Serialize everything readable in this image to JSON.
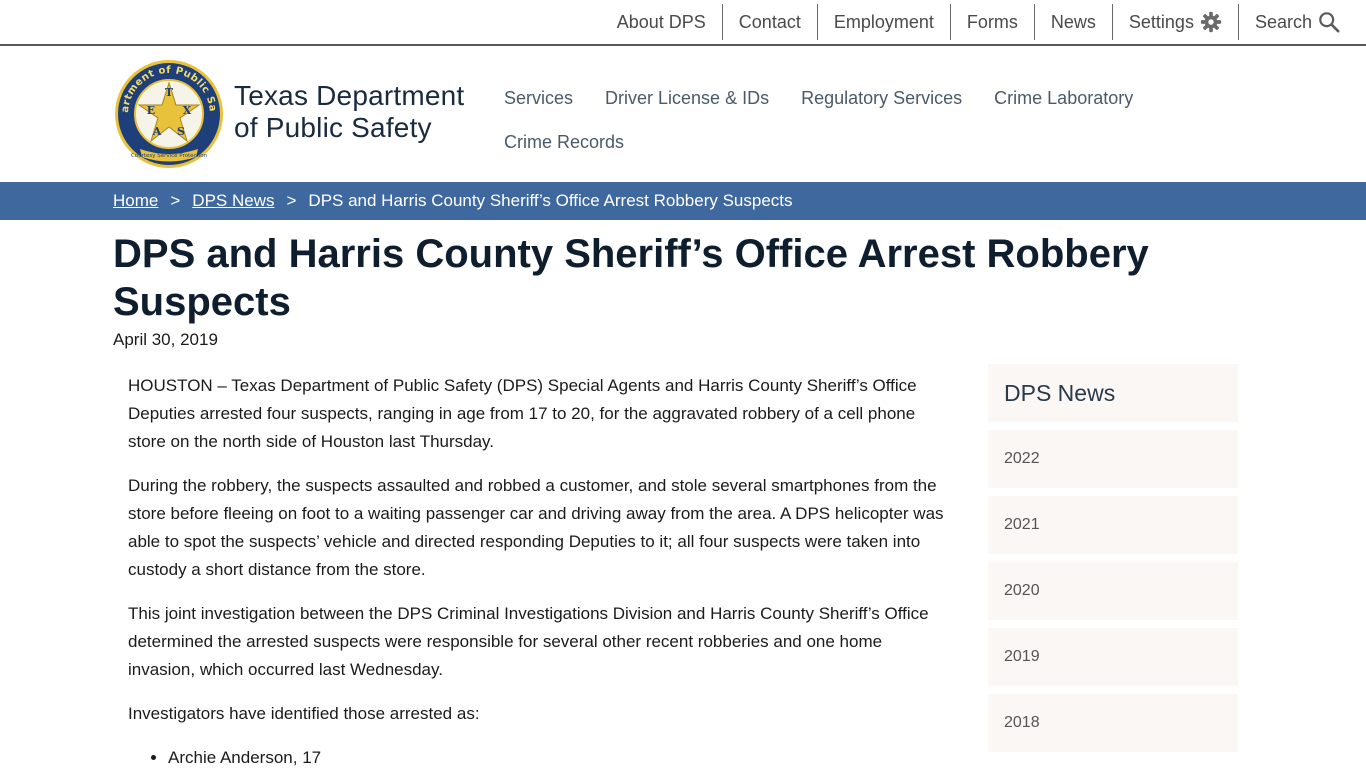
{
  "utility_nav": {
    "items": [
      "About DPS",
      "Contact",
      "Employment",
      "Forms",
      "News"
    ],
    "settings_label": "Settings",
    "search_label": "Search"
  },
  "header": {
    "agency_line1": "Texas Department",
    "agency_line2": "of Public Safety",
    "seal": {
      "ring_text": "Department of Public Safety",
      "star_letters": [
        "T",
        "E",
        "X",
        "A",
        "S"
      ],
      "ribbon_text": "Courtesy Service Protection"
    }
  },
  "main_nav": {
    "items": [
      "Services",
      "Driver License & IDs",
      "Regulatory Services",
      "Crime Laboratory",
      "Crime Records"
    ]
  },
  "breadcrumb": {
    "home": "Home",
    "news": "DPS News",
    "separator": ">",
    "current": "DPS and Harris County Sheriff’s Office Arrest Robbery Suspects"
  },
  "article": {
    "title": "DPS and Harris County Sheriff’s Office Arrest Robbery Suspects",
    "date": "April 30, 2019",
    "paragraphs": [
      "HOUSTON – Texas Department of Public Safety (DPS) Special Agents and Harris County Sheriff’s Office Deputies arrested four suspects, ranging in age from 17 to 20, for the aggravated robbery of a cell phone store on the north side of Houston last Thursday.",
      "During the robbery, the suspects assaulted and robbed a customer, and stole several smartphones from the store before fleeing on foot to a waiting passenger car and driving away from the area. A DPS helicopter was able to spot the suspects’ vehicle and directed responding Deputies to it; all four suspects were taken into custody a short distance from the store.",
      "This joint investigation between the DPS Criminal Investigations Division and Harris County Sheriff’s Office determined the arrested suspects were responsible for several other recent robberies and one home invasion, which occurred last Wednesday.",
      "Investigators have identified those arrested as:"
    ],
    "arrested": [
      "Archie Anderson, 17"
    ]
  },
  "sidebar": {
    "title": "DPS News",
    "years": [
      "2022",
      "2021",
      "2020",
      "2019",
      "2018"
    ]
  },
  "colors": {
    "breadcrumb_bg": "#3f689f",
    "title": "#0f1e2e",
    "sidebar_bg": "#faf7f5",
    "seal_blue": "#1f3f7a",
    "seal_gold": "#e8c23a"
  }
}
